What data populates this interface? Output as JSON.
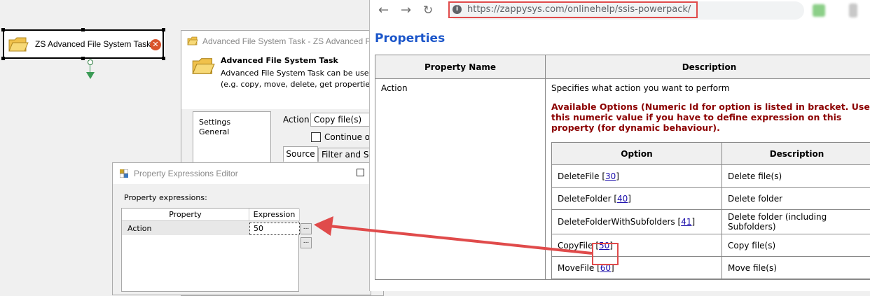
{
  "canvas": {
    "task_title": "ZS Advanced File System Task",
    "error_glyph": "✕"
  },
  "afs_dialog": {
    "title": "Advanced File System Task - ZS Advanced File",
    "header_title": "Advanced File System Task",
    "header_desc_1": "Advanced File System Task can be used f",
    "header_desc_2": "(e.g. copy, move, delete, get properties)",
    "nav_items": [
      "Settings",
      "General"
    ],
    "action_label": "Action",
    "action_value": "Copy file(s)",
    "continue_label": "Continue or",
    "tab_source": "Source",
    "tab_filter": "Filter and Sor"
  },
  "pee_dialog": {
    "title": "Property Expressions Editor",
    "label": "Property expressions:",
    "col_property": "Property",
    "col_expression": "Expression",
    "rows": [
      {
        "property": "Action",
        "expression": "50"
      }
    ],
    "ellipsis": "..."
  },
  "browser": {
    "url": "https://zappysys.com/onlinehelp/ssis-powerpack/",
    "page_title": "Properties",
    "table_headers": [
      "Property Name",
      "Description"
    ],
    "property_name": "Action",
    "property_desc": "Specifies what action you want to perform",
    "options_note": "Available Options (Numeric Id for option is listed in bracket. Use this numeric value if you have to define expression on this property (for dynamic behaviour).",
    "option_headers": [
      "Option",
      "Description"
    ],
    "options": [
      {
        "name": "DeleteFile",
        "code": "30",
        "desc": "Delete file(s)"
      },
      {
        "name": "DeleteFolder",
        "code": "40",
        "desc": "Delete folder"
      },
      {
        "name": "DeleteFolderWithSubfolders",
        "code": "41",
        "desc": "Delete folder (including Subfolders)"
      },
      {
        "name": "CopyFile",
        "code": "50",
        "desc": "Copy file(s)"
      },
      {
        "name": "MoveFile",
        "code": "60",
        "desc": "Move file(s)"
      }
    ]
  },
  "colors": {
    "highlight_red": "#e04b4b",
    "link_blue": "#1a55c9",
    "warn_red": "#8b0000",
    "ssis_green": "#3b9b56"
  }
}
